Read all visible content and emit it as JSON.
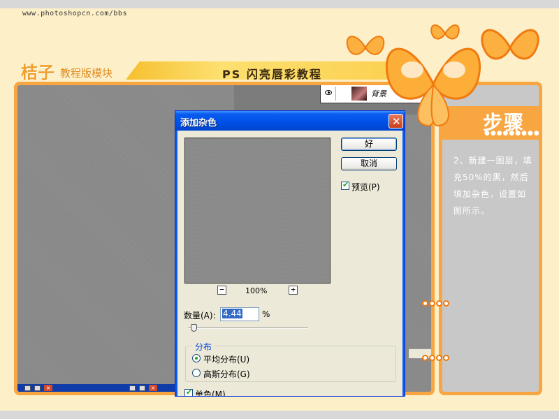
{
  "site_url": "www.photoshopcn.com/bbs",
  "header": {
    "brand_name": "桔子",
    "brand_sub": "教程版模块",
    "tutorial_title": "PS 闪亮唇彩教程"
  },
  "photoshop": {
    "layer_label": "背景"
  },
  "dialog": {
    "title": "添加杂色",
    "ok_label": "好",
    "cancel_label": "取消",
    "preview_label": "预览(P)",
    "zoom_minus": "−",
    "zoom_plus": "+",
    "zoom_level": "100%",
    "amount_label": "数量(A):",
    "amount_value": "4.44",
    "amount_unit": "%",
    "distribution_legend": "分布",
    "uniform_label": "平均分布(U)",
    "gaussian_label": "高斯分布(G)",
    "mono_label": "单色(M)",
    "preview_checked": true,
    "uniform_selected": true
  },
  "step_panel": {
    "title": "步骤",
    "dots": "●●●●●●●●●●●",
    "text": "2、新建一图层，填充50%的黑，然后填加杂色，设置如图所示。"
  },
  "colors": {
    "frame_orange": "#f7a642",
    "background_cream": "#fdf0c8",
    "xp_title_blue": "#0050e8"
  }
}
